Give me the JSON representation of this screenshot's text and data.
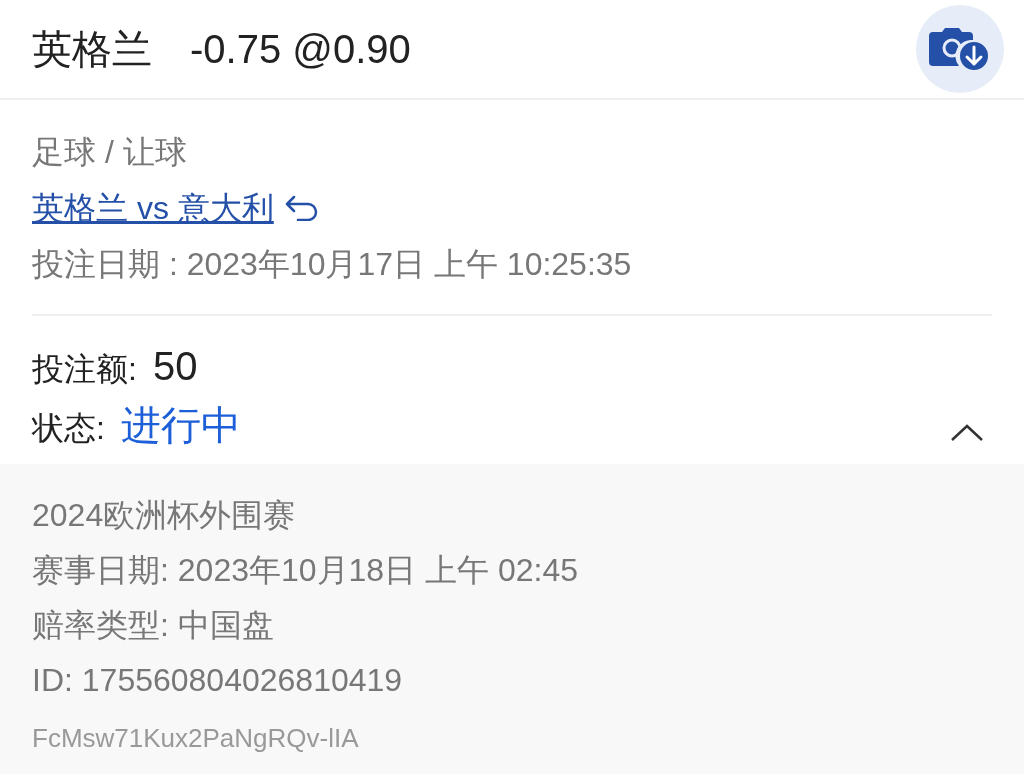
{
  "header": {
    "team": "英格兰",
    "odds": "-0.75 @0.90"
  },
  "bet": {
    "category": "足球 / 让球",
    "match_link": "英格兰 vs 意大利",
    "bet_date": "投注日期 : 2023年10月17日 上午 10:25:35"
  },
  "summary": {
    "stake_label": "投注额:",
    "stake": "50",
    "status_label": "状态:",
    "status": "进行中",
    "expanded": true
  },
  "details": [
    "2024欧洲杯外围赛",
    "赛事日期: 2023年10月18日 上午 02:45",
    "赔率类型: 中国盘",
    "ID: 175560804026810419"
  ],
  "reference": "FcMsw71Kux2PaNgRQv-lIA"
}
